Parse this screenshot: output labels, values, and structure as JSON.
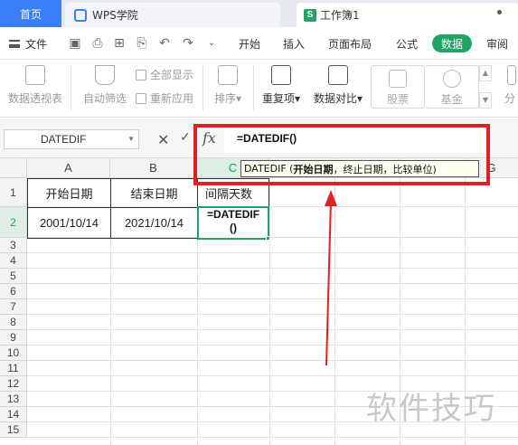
{
  "titlebar": {
    "home_tab": "首页",
    "wps_tab": "WPS学院",
    "book_tab": "工作簿1",
    "book_icon": "S"
  },
  "menubar": {
    "file": "文件",
    "items": [
      "开始",
      "插入",
      "页面布局",
      "公式",
      "数据",
      "审阅"
    ],
    "active": "数据"
  },
  "ribbon": {
    "pivot": "数据透视表",
    "autofilter": "自动筛选",
    "show_all": "全部显示",
    "reapply": "重新应用",
    "sort": "排序",
    "duplicates": "重复项",
    "compare": "数据对比",
    "stocks": "股票",
    "funds": "基金",
    "split": "分"
  },
  "formula_bar": {
    "name_box": "DATEDIF",
    "fx": "fx",
    "cancel": "✕",
    "confirm": "✓",
    "formula": "=DATEDIF()"
  },
  "tooltip": {
    "func": "DATEDIF (",
    "arg1": "开始日期",
    "rest": "，终止日期，比较单位)"
  },
  "grid": {
    "columns": [
      "A",
      "B",
      "C",
      "G"
    ],
    "rows": [
      "1",
      "2",
      "3",
      "4",
      "5",
      "6",
      "7",
      "8",
      "9",
      "10",
      "11",
      "12",
      "13",
      "14",
      "15"
    ],
    "A1": "开始日期",
    "B1": "结束日期",
    "C1": "间隔天数",
    "A2": "2001/10/14",
    "B2": "2021/10/14",
    "C2": "=DATEDIF\n()"
  },
  "watermark": "软件技巧",
  "colors": {
    "accent_green": "#1fa466",
    "home_blue": "#3a7ff6",
    "annotation_red": "#e31f26"
  }
}
